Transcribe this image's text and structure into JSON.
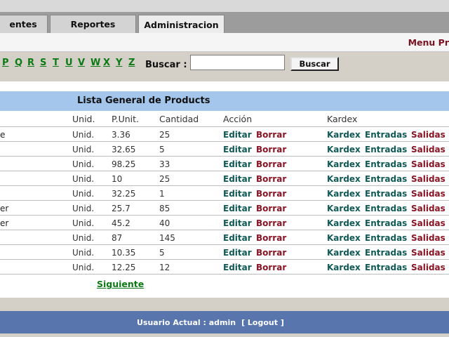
{
  "tabs": [
    {
      "label": "entes",
      "active": false
    },
    {
      "label": "Reportes",
      "active": false
    },
    {
      "label": "Administracion",
      "active": true
    }
  ],
  "menu": {
    "label": "Menu Pr"
  },
  "letters": [
    "P",
    "Q",
    "R",
    "S",
    "T",
    "U",
    "V",
    "W",
    "X",
    "Y",
    "Z"
  ],
  "search": {
    "label": "Buscar :",
    "value": "",
    "button": "Buscar"
  },
  "list": {
    "title": "Lista General de Products",
    "headers": {
      "unid": "Unid.",
      "punit": "P.Unit.",
      "qty": "Cantidad",
      "action": "Acción",
      "kardex": "Kardex"
    },
    "actions": {
      "edit": "Editar",
      "delete": "Borrar",
      "kardex": "Kardex",
      "entradas": "Entradas",
      "salidas": "Salidas"
    },
    "rows": [
      {
        "name": "e",
        "unid": "Unid.",
        "punit": "3.36",
        "qty": "25"
      },
      {
        "name": "",
        "unid": "Unid.",
        "punit": "32.65",
        "qty": "5"
      },
      {
        "name": "",
        "unid": "Unid.",
        "punit": "98.25",
        "qty": "33"
      },
      {
        "name": "",
        "unid": "Unid.",
        "punit": "10",
        "qty": "25"
      },
      {
        "name": "",
        "unid": "Unid.",
        "punit": "32.25",
        "qty": "1"
      },
      {
        "name": "er",
        "unid": "Unid.",
        "punit": "25.7",
        "qty": "85"
      },
      {
        "name": "er",
        "unid": "Unid.",
        "punit": "45.2",
        "qty": "40"
      },
      {
        "name": "",
        "unid": "Unid.",
        "punit": "87",
        "qty": "145"
      },
      {
        "name": "",
        "unid": "Unid.",
        "punit": "10.35",
        "qty": "5"
      },
      {
        "name": "",
        "unid": "Unid.",
        "punit": "12.25",
        "qty": "12"
      }
    ],
    "next": "Siguiente"
  },
  "footer": {
    "user": "Usuario Actual : admin",
    "logout": "[ Logout ]"
  }
}
